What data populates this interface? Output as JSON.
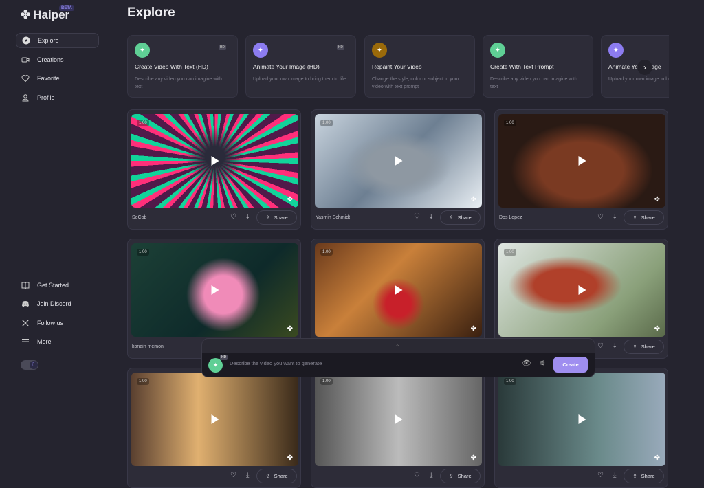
{
  "brand": {
    "name": "Haiper",
    "badge": "BETA"
  },
  "sidebar": {
    "items": [
      {
        "label": "Explore",
        "icon": "compass-icon",
        "active": true
      },
      {
        "label": "Creations",
        "icon": "video-icon"
      },
      {
        "label": "Favorite",
        "icon": "heart-icon"
      },
      {
        "label": "Profile",
        "icon": "user-icon"
      }
    ],
    "bottom": [
      {
        "label": "Get Started",
        "icon": "book-icon"
      },
      {
        "label": "Join Discord",
        "icon": "discord-icon"
      },
      {
        "label": "Follow us",
        "icon": "x-icon"
      },
      {
        "label": "More",
        "icon": "menu-icon"
      }
    ],
    "theme_toggle": "dark"
  },
  "page_title": "Explore",
  "features": [
    {
      "title": "Create Video With Text (HD)",
      "desc": "Describe any video you can imagine with text",
      "hd": "HD",
      "color": "#5fcf95"
    },
    {
      "title": "Animate Your Image (HD)",
      "desc": "Upload your own image to bring them to life",
      "hd": "HD",
      "color": "#8c7cf0"
    },
    {
      "title": "Repaint Your Video",
      "desc": "Change the style, color or subject in your video with text prompt",
      "color": "#9a6a0a"
    },
    {
      "title": "Create With Text Prompt",
      "desc": "Describe any video you can imagine with text",
      "color": "#5fcf95"
    },
    {
      "title": "Animate Your Image",
      "desc": "Upload your own image to bring them to life",
      "color": "#8c7cf0"
    }
  ],
  "videos": [
    {
      "author": "SeCob",
      "duration": "1.00"
    },
    {
      "author": "Yasmin Schmidt",
      "duration": "1.00"
    },
    {
      "author": "Dos Lopez",
      "duration": "1.00"
    },
    {
      "author": "konain memon",
      "duration": "1.00"
    },
    {
      "author": "",
      "duration": "1.00"
    },
    {
      "author": "",
      "duration": "1.00"
    },
    {
      "author": "",
      "duration": "1.00"
    },
    {
      "author": "",
      "duration": "1.00"
    },
    {
      "author": "",
      "duration": "1.00"
    }
  ],
  "share_label": "Share",
  "prompt": {
    "placeholder": "Describe the video you want to generate",
    "hd": "HD",
    "create_label": "Create"
  }
}
